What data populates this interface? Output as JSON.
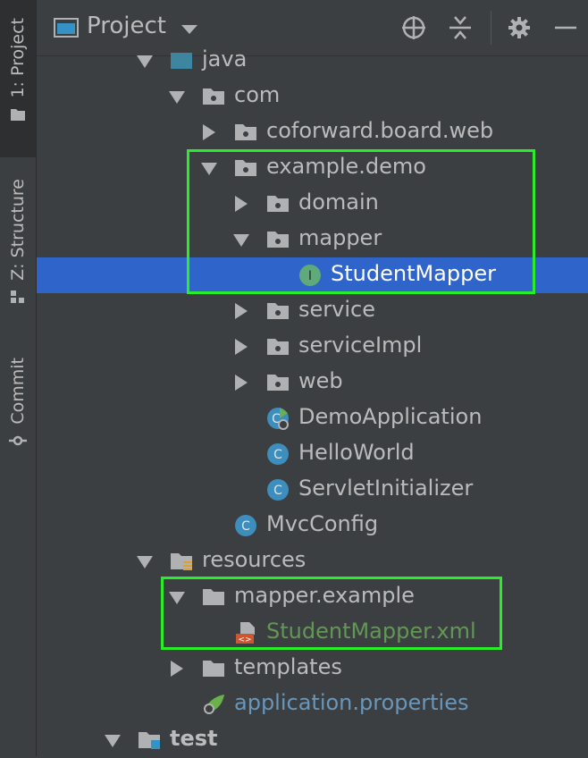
{
  "toolstrip": {
    "project_tab": "1: Project",
    "structure_tab": "Z: Structure",
    "commit_tab": "Commit"
  },
  "header": {
    "title": "Project"
  },
  "tree": [
    {
      "label": "java",
      "depth": 0,
      "state": "expanded",
      "icon": "source-folder-icon",
      "style": "normal"
    },
    {
      "label": "com",
      "depth": 1,
      "state": "expanded",
      "icon": "package-icon",
      "style": "normal"
    },
    {
      "label": "coforward.board.web",
      "depth": 2,
      "state": "collapsed",
      "icon": "package-icon",
      "style": "normal"
    },
    {
      "label": "example.demo",
      "depth": 2,
      "state": "expanded",
      "icon": "package-icon",
      "style": "normal"
    },
    {
      "label": "domain",
      "depth": 3,
      "state": "collapsed",
      "icon": "package-icon",
      "style": "normal"
    },
    {
      "label": "mapper",
      "depth": 3,
      "state": "expanded",
      "icon": "package-icon",
      "style": "normal"
    },
    {
      "label": "StudentMapper",
      "depth": 4,
      "state": "leaf",
      "icon": "interface-icon",
      "style": "selected"
    },
    {
      "label": "service",
      "depth": 3,
      "state": "collapsed",
      "icon": "package-icon",
      "style": "normal"
    },
    {
      "label": "serviceImpl",
      "depth": 3,
      "state": "collapsed",
      "icon": "package-icon",
      "style": "normal"
    },
    {
      "label": "web",
      "depth": 3,
      "state": "collapsed",
      "icon": "package-icon",
      "style": "normal"
    },
    {
      "label": "DemoApplication",
      "depth": 3,
      "state": "leaf",
      "icon": "spring-boot-class-icon",
      "style": "normal"
    },
    {
      "label": "HelloWorld",
      "depth": 3,
      "state": "leaf",
      "icon": "class-icon",
      "style": "normal"
    },
    {
      "label": "ServletInitializer",
      "depth": 3,
      "state": "leaf",
      "icon": "class-icon",
      "style": "normal"
    },
    {
      "label": "MvcConfig",
      "depth": 2,
      "state": "leaf",
      "icon": "class-icon",
      "style": "normal"
    },
    {
      "label": "resources",
      "depth": 0,
      "state": "expanded",
      "icon": "resources-folder-icon",
      "style": "normal"
    },
    {
      "label": "mapper.example",
      "depth": 1,
      "state": "expanded",
      "icon": "folder-icon",
      "style": "normal"
    },
    {
      "label": "StudentMapper.xml",
      "depth": 2,
      "state": "leaf",
      "icon": "xml-file-icon",
      "style": "green"
    },
    {
      "label": "templates",
      "depth": 1,
      "state": "collapsed",
      "icon": "folder-icon",
      "style": "normal"
    },
    {
      "label": "application.properties",
      "depth": 1,
      "state": "leaf",
      "icon": "spring-properties-icon",
      "style": "blue"
    },
    {
      "label": "test",
      "depth": -1,
      "state": "expanded",
      "icon": "test-folder-icon",
      "style": "bold"
    }
  ],
  "colors": {
    "background": "#3c3f41",
    "selection": "#2f65ca",
    "highlight_box": "#28ed28",
    "class_icon": "#3d8dbd",
    "interface_icon": "#5fa97a",
    "xml_green": "#629755",
    "properties_blue": "#6897bb"
  }
}
